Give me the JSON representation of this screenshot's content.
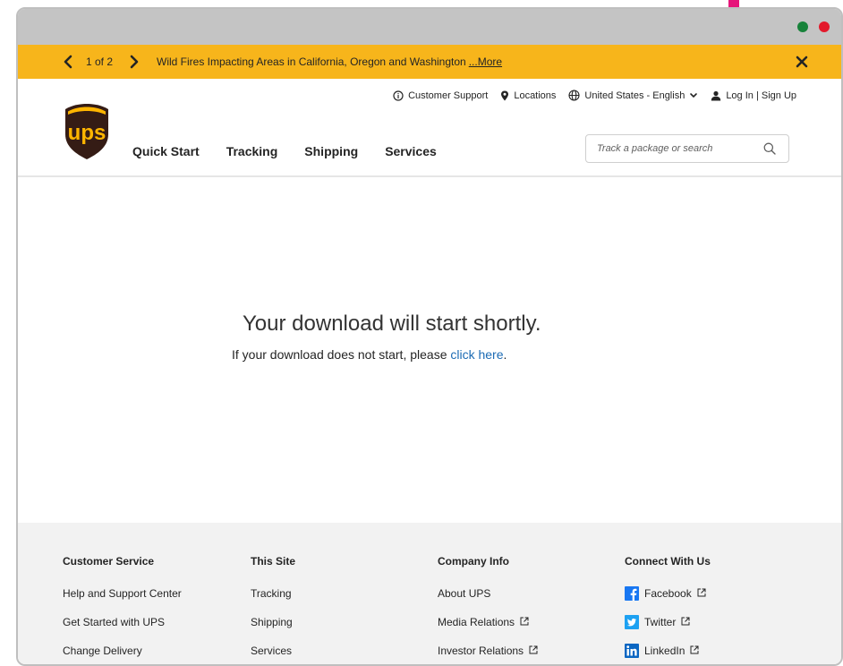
{
  "alert": {
    "counter": "1 of 2",
    "message": "Wild Fires Impacting Areas in California, Oregon and Washington",
    "more": "...More"
  },
  "utility": {
    "support": "Customer Support",
    "locations": "Locations",
    "language": "United States - English",
    "login": "Log In | Sign Up"
  },
  "nav": [
    "Quick Start",
    "Tracking",
    "Shipping",
    "Services"
  ],
  "search": {
    "placeholder": "Track a package or search"
  },
  "main": {
    "headline": "Your download will start shortly.",
    "sub_prefix": "If your download does not start, please ",
    "sub_link": "click here",
    "sub_suffix": "."
  },
  "footer": {
    "customer_service": {
      "heading": "Customer Service",
      "links": [
        "Help and Support Center",
        "Get Started with UPS",
        "Change Delivery"
      ]
    },
    "this_site": {
      "heading": "This Site",
      "links": [
        "Tracking",
        "Shipping",
        "Services"
      ]
    },
    "company_info": {
      "heading": "Company Info",
      "links": [
        "About UPS",
        "Media Relations",
        "Investor Relations"
      ]
    },
    "connect": {
      "heading": "Connect With Us",
      "links": [
        "Facebook",
        "Twitter",
        "LinkedIn"
      ]
    }
  },
  "colors": {
    "banner": "#f7b51b",
    "ups_brown": "#351c15",
    "ups_gold": "#ffb500",
    "link_blue": "#1c6bb4",
    "footer_bg": "#f2f2f2"
  },
  "icons": {
    "prev": "chevron-left-icon",
    "next": "chevron-right-icon",
    "close": "close-icon",
    "support": "info-circle-icon",
    "locations": "location-pin-icon",
    "language": "globe-icon",
    "login": "user-icon",
    "search": "search-icon"
  }
}
